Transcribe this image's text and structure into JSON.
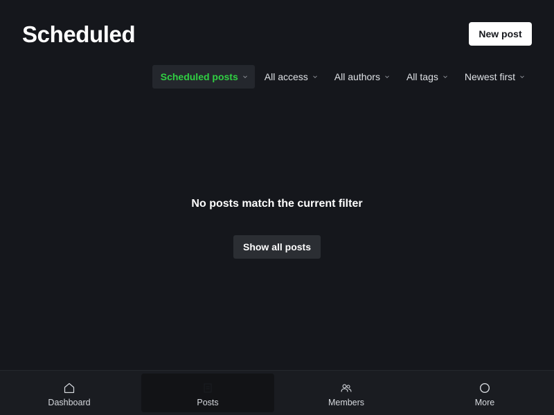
{
  "header": {
    "title": "Scheduled",
    "new_post_label": "New post"
  },
  "filters": [
    {
      "label": "Scheduled posts",
      "active": true
    },
    {
      "label": "All access",
      "active": false
    },
    {
      "label": "All authors",
      "active": false
    },
    {
      "label": "All tags",
      "active": false
    },
    {
      "label": "Newest first",
      "active": false
    }
  ],
  "empty_state": {
    "message": "No posts match the current filter",
    "button_label": "Show all posts"
  },
  "bottom_nav": {
    "items": [
      {
        "label": "Dashboard",
        "icon": "home-icon",
        "active": false
      },
      {
        "label": "Posts",
        "icon": "posts-icon",
        "active": true
      },
      {
        "label": "Members",
        "icon": "members-icon",
        "active": false
      },
      {
        "label": "More",
        "icon": "circle-icon",
        "active": false
      }
    ]
  },
  "colors": {
    "background": "#15171c",
    "accent_green": "#30cf43",
    "active_filter_bg": "#24272d",
    "nav_bg": "#1a1c21"
  }
}
